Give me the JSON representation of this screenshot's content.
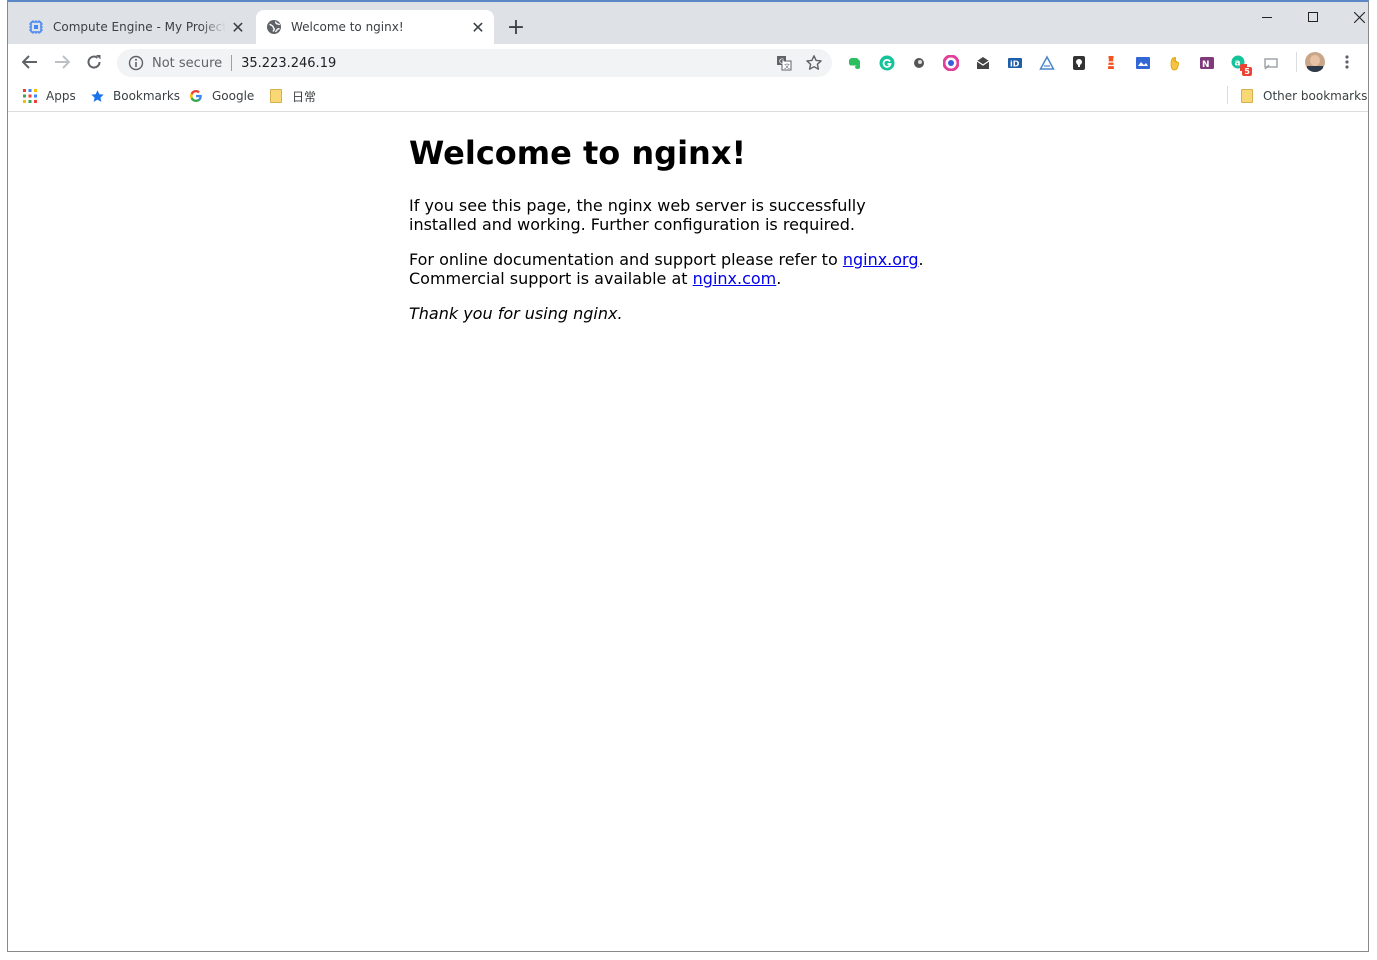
{
  "tabs": [
    {
      "title": "Compute Engine - My Project - Google Cloud Platform",
      "close": "✕"
    },
    {
      "title": "Welcome to nginx!",
      "close": "✕"
    }
  ],
  "new_tab": "+",
  "omnibox": {
    "security_label": "Not secure",
    "url": "35.223.246.19"
  },
  "bookmarks": [
    {
      "label": "Apps"
    },
    {
      "label": "Bookmarks"
    },
    {
      "label": "Google"
    },
    {
      "label": "日常"
    }
  ],
  "other_bookmarks": "Other bookmarks",
  "extensions": [
    {
      "icon": "evernote-icon",
      "color": "#2dbe60"
    },
    {
      "icon": "grammarly-icon",
      "color": "#15c39a"
    },
    {
      "icon": "circle-extension-icon",
      "color": "#555555"
    },
    {
      "icon": "color-picker-icon",
      "color": "#e0409a"
    },
    {
      "icon": "mail-icon",
      "color": "#444444"
    },
    {
      "icon": "id-extension-icon",
      "color": "#1f5ea8"
    },
    {
      "icon": "drive-triangle-icon",
      "color": "#4a86c8"
    },
    {
      "icon": "keep-icon",
      "color": "#333333"
    },
    {
      "icon": "lighthouse-icon",
      "color": "#f4511e"
    },
    {
      "icon": "puzzle-extension-icon",
      "color": "#3367d6"
    },
    {
      "icon": "hand-icon",
      "color": "#d8a300"
    },
    {
      "icon": "onenote-icon",
      "color": "#80397b"
    },
    {
      "icon": "grammar-badge-icon",
      "color": "#15c39a",
      "badge": "5"
    },
    {
      "icon": "cast-icon",
      "color": "#9aa0a6"
    }
  ],
  "page": {
    "heading": "Welcome to nginx!",
    "para1": "If you see this page, the nginx web server is successfully installed and working. Further configuration is required.",
    "para2_prefix": "For online documentation and support please refer to ",
    "link_org": "nginx.org",
    "para2_mid": ".",
    "para2_line2": "Commercial support is available at ",
    "link_com": "nginx.com",
    "para2_end": ".",
    "thanks": "Thank you for using nginx."
  }
}
